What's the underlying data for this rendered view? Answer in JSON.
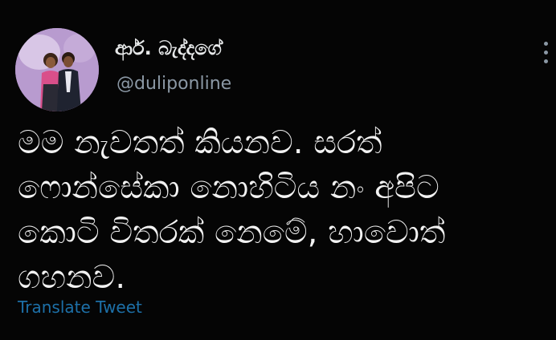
{
  "tweet": {
    "display_name": "ආර්. බැද්දගේ",
    "handle": "@duliponline",
    "text_lines": [
      "මම නැවතත් කියනව. සරත්",
      "ෆොන්සේකා නොහිටිය නං අපිට",
      "කොටි විතරක් නෙමේ, හාවොත්",
      "ගහනව."
    ],
    "translate_label": "Translate Tweet",
    "avatar_icon": "profile-photo",
    "more_icon": "vertical-ellipsis-icon"
  },
  "colors": {
    "background": "#050505",
    "text": "#f2f2f2",
    "secondary_text": "#8b98a5",
    "link": "#1d70a8"
  }
}
